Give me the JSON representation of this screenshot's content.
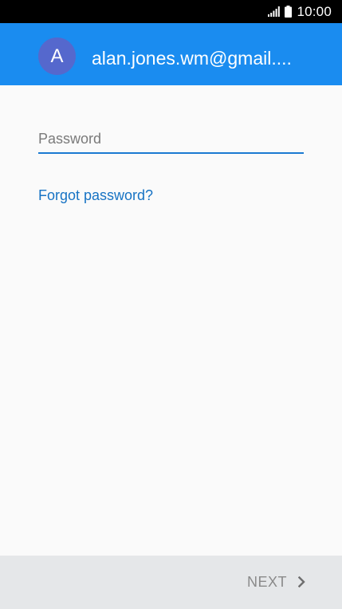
{
  "status_bar": {
    "time": "10:00",
    "icons": [
      "signal-icon",
      "battery-icon"
    ]
  },
  "header": {
    "avatar_letter": "A",
    "account_email": "alan.jones.wm@gmail....",
    "color": "#1a8cf0",
    "avatar_color": "#5568cd"
  },
  "form": {
    "password_placeholder": "Password",
    "password_value": "",
    "forgot_link": "Forgot password?"
  },
  "footer": {
    "next_label": "NEXT",
    "next_icon": "chevron-right-icon"
  }
}
